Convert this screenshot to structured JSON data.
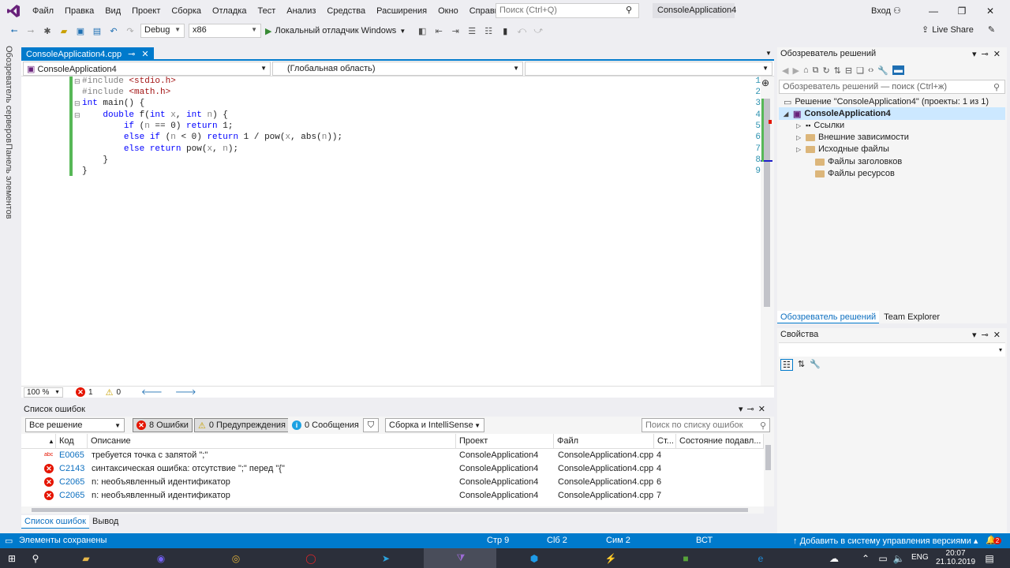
{
  "menu": [
    "Файл",
    "Правка",
    "Вид",
    "Проект",
    "Сборка",
    "Отладка",
    "Тест",
    "Анализ",
    "Средства",
    "Расширения",
    "Окно",
    "Справка"
  ],
  "search_placeholder": "Поиск (Ctrl+Q)",
  "solution_title": "ConsoleApplication4",
  "login": "Вход",
  "toolbar": {
    "config": "Debug",
    "platform": "x86",
    "debugger": "Локальный отладчик Windows",
    "live_share": "Live Share"
  },
  "left_tabs": [
    "Обозреватель серверов",
    "Панель элементов"
  ],
  "editor": {
    "tab": "ConsoleApplication4.cpp",
    "nav_project": "ConsoleApplication4",
    "nav_scope": "(Глобальная область)",
    "zoom": "100 %",
    "errors": "1",
    "warnings": "0"
  },
  "code_lines": [
    "#include <stdio.h>",
    "#include <math.h>",
    "int main() {",
    "    double f(int x, int n) {",
    "        if (n == 0) return 1;",
    "        else if (n < 0) return 1 / pow(x, abs(n));",
    "        else return pow(x, n);",
    "    }",
    "}"
  ],
  "line_numbers": [
    "1",
    "2",
    "3",
    "4",
    "5",
    "6",
    "7",
    "8",
    "9"
  ],
  "error_list": {
    "title": "Список ошибок",
    "scope": "Все решение",
    "errors_btn": "8 Ошибки",
    "warnings_btn": "0 Предупреждения",
    "messages_btn": "0 Сообщения",
    "build_filter": "Сборка и IntelliSense",
    "search_placeholder": "Поиск по списку ошибок",
    "columns": [
      "Код",
      "Описание",
      "Проект",
      "Файл",
      "Ст...",
      "Состояние подавл..."
    ],
    "rows": [
      {
        "code": "E0065",
        "desc": "требуется точка с запятой \";\"",
        "project": "ConsoleApplication4",
        "file": "ConsoleApplication4.cpp",
        "line": "4"
      },
      {
        "code": "C2143",
        "desc": "синтаксическая ошибка: отсутствие \";\" перед \"{\"",
        "project": "ConsoleApplication4",
        "file": "ConsoleApplication4.cpp",
        "line": "4"
      },
      {
        "code": "C2065",
        "desc": "n: необъявленный идентификатор",
        "project": "ConsoleApplication4",
        "file": "ConsoleApplication4.cpp",
        "line": "6"
      },
      {
        "code": "C2065",
        "desc": "n: необъявленный идентификатор",
        "project": "ConsoleApplication4",
        "file": "ConsoleApplication4.cpp",
        "line": "7"
      }
    ],
    "tabs": [
      "Список ошибок",
      "Вывод"
    ]
  },
  "solution_explorer": {
    "title": "Обозреватель решений",
    "search_placeholder": "Обозреватель решений — поиск (Ctrl+ж)",
    "solution": "Решение \"ConsoleApplication4\" (проекты: 1 из 1)",
    "project": "ConsoleApplication4",
    "items": [
      "Ссылки",
      "Внешние зависимости",
      "Исходные файлы",
      "Файлы заголовков",
      "Файлы ресурсов"
    ],
    "tabs": [
      "Обозреватель решений",
      "Team Explorer"
    ]
  },
  "properties": {
    "title": "Свойства"
  },
  "statusbar": {
    "message": "Элементы сохранены",
    "line": "Стр 9",
    "col": "Clб 2",
    "char": "Сим 2",
    "mode": "ВСТ",
    "vcs": "Добавить в систему управления версиями",
    "notifications": "2"
  },
  "taskbar": {
    "lang": "ENG",
    "time": "20:07",
    "date": "21.10.2019"
  },
  "colors": {
    "accent": "#007acc",
    "error": "#e51400",
    "keyword": "#0000ff",
    "string": "#a31515"
  }
}
